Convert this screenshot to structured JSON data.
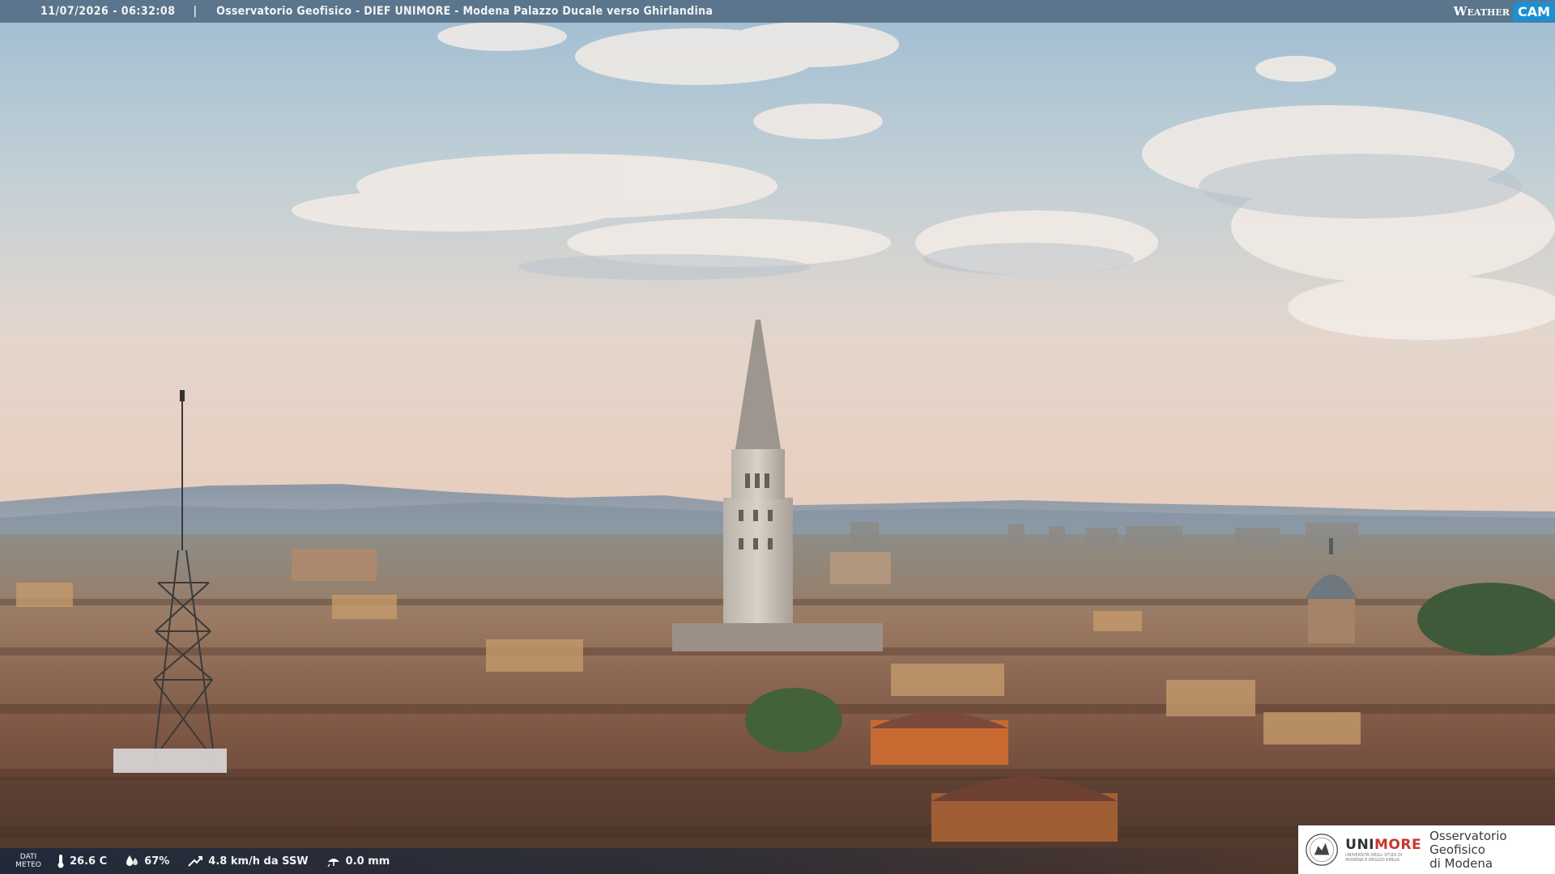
{
  "header": {
    "timestamp": "11/07/2026 - 06:32:08",
    "separator": "|",
    "title": "Osservatorio Geofisico - DIEF UNIMORE - Modena Palazzo Ducale verso Ghirlandina",
    "logo_weather": "Weather",
    "logo_cam": "CAM"
  },
  "weather": {
    "label_line1": "DATI",
    "label_line2": "METEO",
    "temperature": "26.6 C",
    "humidity": "67%",
    "wind": "4.8 km/h da SSW",
    "rain": "0.0 mm",
    "icons": [
      "thermometer-icon",
      "humidity-icon",
      "wind-icon",
      "rain-icon"
    ]
  },
  "branding": {
    "uni_name_a": "UNI",
    "uni_name_b": "MORE",
    "uni_sub_line1": "UNIVERSITÀ DEGLI STUDI DI",
    "uni_sub_line2": "MODENA E REGGIO EMILIA",
    "observatory_line1": "Osservatorio Geofisico",
    "observatory_line2": "di Modena"
  },
  "colors": {
    "sky_top": "#a9c4d6",
    "sky_horizon": "#e7d2c4",
    "roofs": "#8a5a44",
    "accent_more": "#c7352b",
    "cam_blue": "#1e8fd0"
  }
}
